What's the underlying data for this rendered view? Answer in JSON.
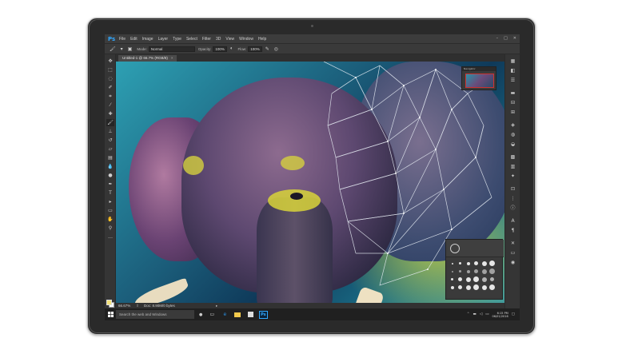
{
  "app": {
    "logo": "Ps",
    "menu": [
      "File",
      "Edit",
      "Image",
      "Layer",
      "Type",
      "Select",
      "Filter",
      "3D",
      "View",
      "Window",
      "Help"
    ],
    "window_controls": [
      "–",
      "□",
      "✕"
    ]
  },
  "options_bar": {
    "mode_label": "Mode:",
    "mode_value": "Normal",
    "opacity_label": "Opacity:",
    "opacity_value": "100%",
    "flow_label": "Flow:",
    "flow_value": "100%"
  },
  "document_tab": {
    "title": "Untitled-1 @ 66.7% (RGB/8)",
    "close": "×"
  },
  "navigator": {
    "title": "Navigator"
  },
  "status": {
    "zoom": "66.67%",
    "doc": "Doc: 8.90M/0 bytes",
    "arrow": "▸"
  },
  "taskbar": {
    "search_placeholder": "Search the web and Windows",
    "mic": "🎤",
    "ps": "Ps",
    "clock_time": "6:15 PM",
    "clock_date": "06/01/2016"
  },
  "colors": {
    "ps_blue": "#31a8ff",
    "foreground_swatch": "#f4e27a",
    "taskbar": "#202020"
  }
}
